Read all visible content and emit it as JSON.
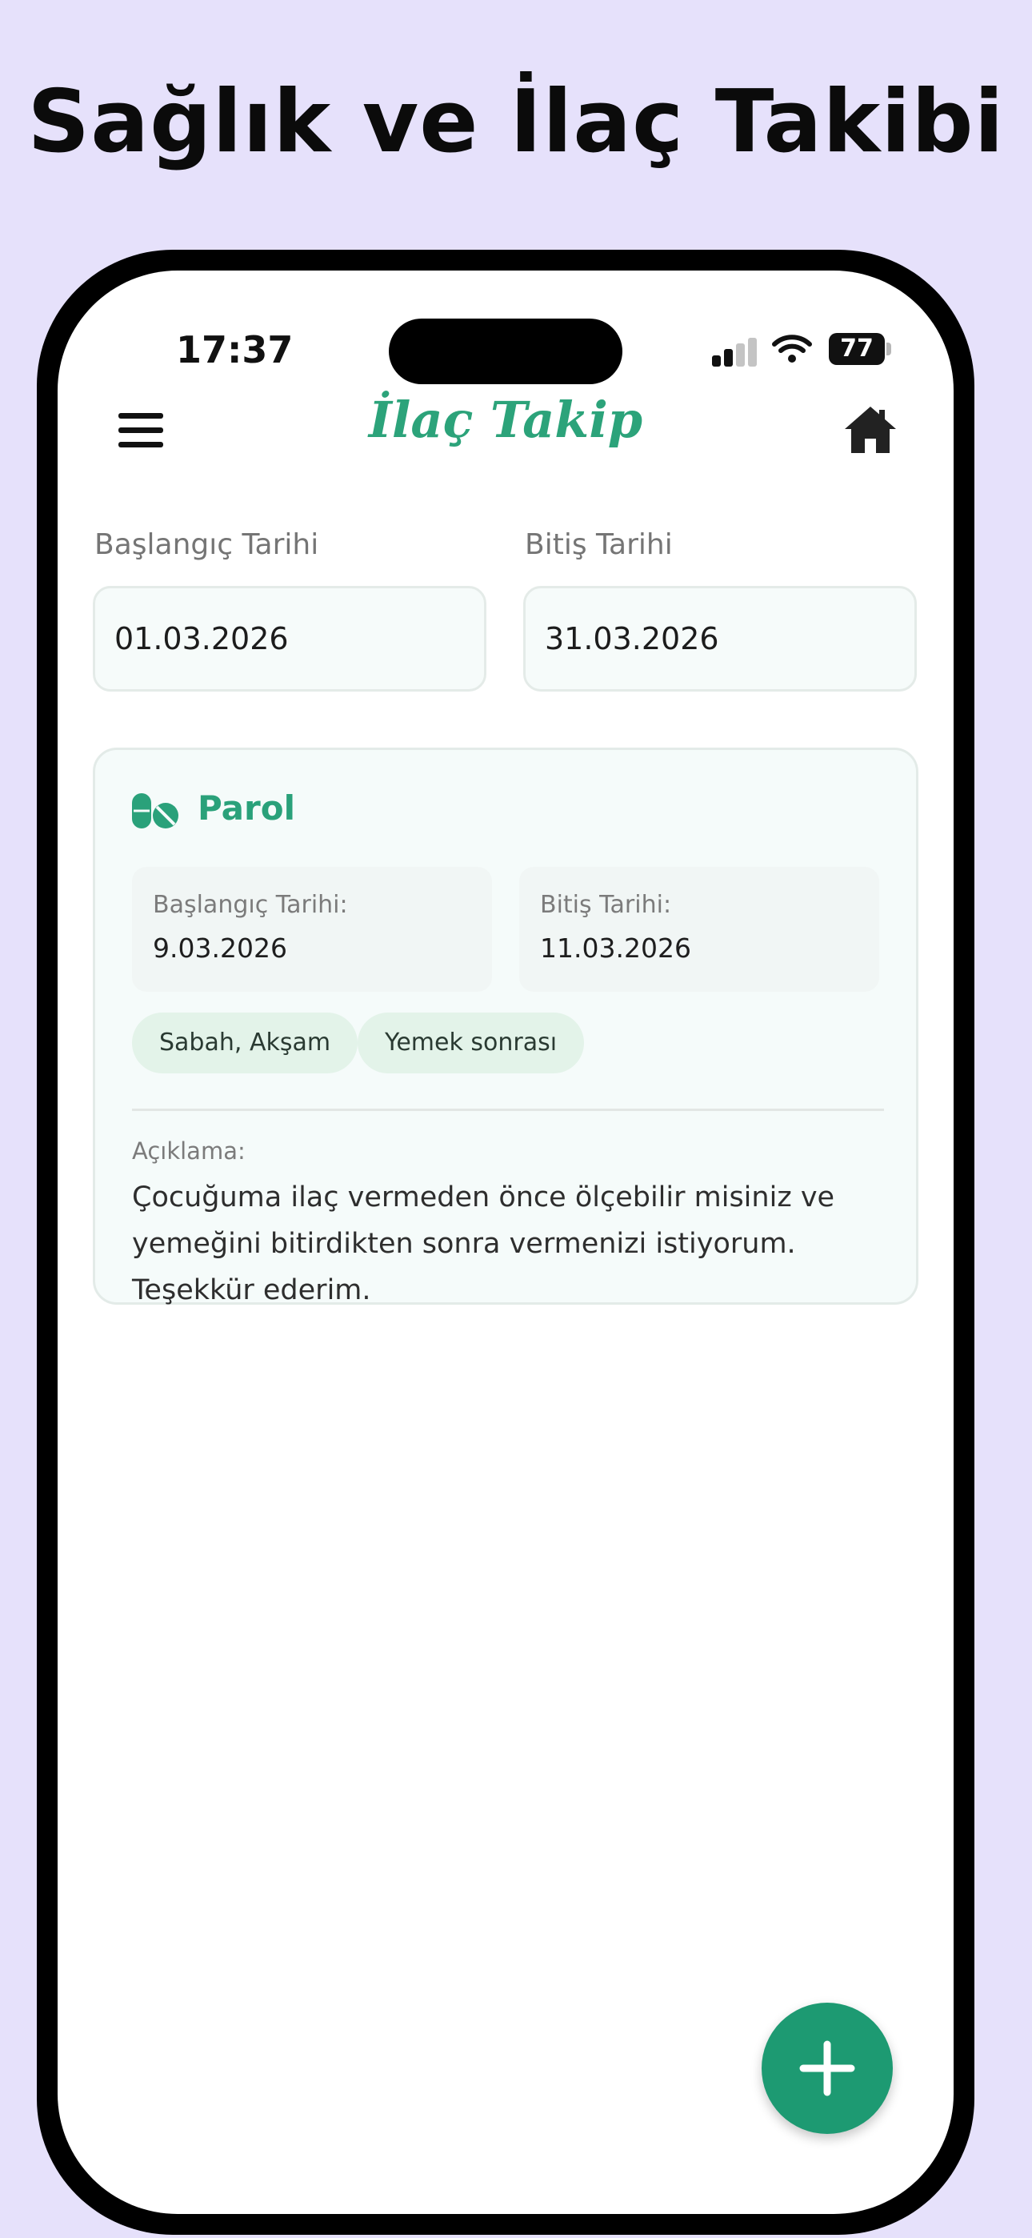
{
  "banner": {
    "title": "Sağlık ve İlaç Takibi"
  },
  "status_bar": {
    "time": "17:37",
    "battery": "77"
  },
  "header": {
    "menu_icon": "hamburger-menu-icon",
    "title": "İlaç Takip",
    "home_icon": "home-icon"
  },
  "filters": {
    "start_label": "Başlangıç Tarihi",
    "start_value": "01.03.2026",
    "end_label": "Bitiş Tarihi",
    "end_value": "31.03.2026"
  },
  "medications": [
    {
      "icon": "pills-icon",
      "name": "Parol",
      "start_label": "Başlangıç Tarihi:",
      "start_value": "9.03.2026",
      "end_label": "Bitiş Tarihi:",
      "end_value": "11.03.2026",
      "tags": [
        "Sabah, Akşam",
        "Yemek sonrası"
      ],
      "description_label": "Açıklama:",
      "description": "Çocuğuma ilaç vermeden önce ölçebilir misiniz ve yemeğini bitirdikten sonra vermenizi istiyorum. Teşekkür ederim."
    }
  ],
  "fab": {
    "icon": "plus-icon"
  },
  "colors": {
    "background": "#e6e1fb",
    "accent": "#2ca37a",
    "fab": "#1d9a72",
    "chip": "#e3f3e9"
  }
}
